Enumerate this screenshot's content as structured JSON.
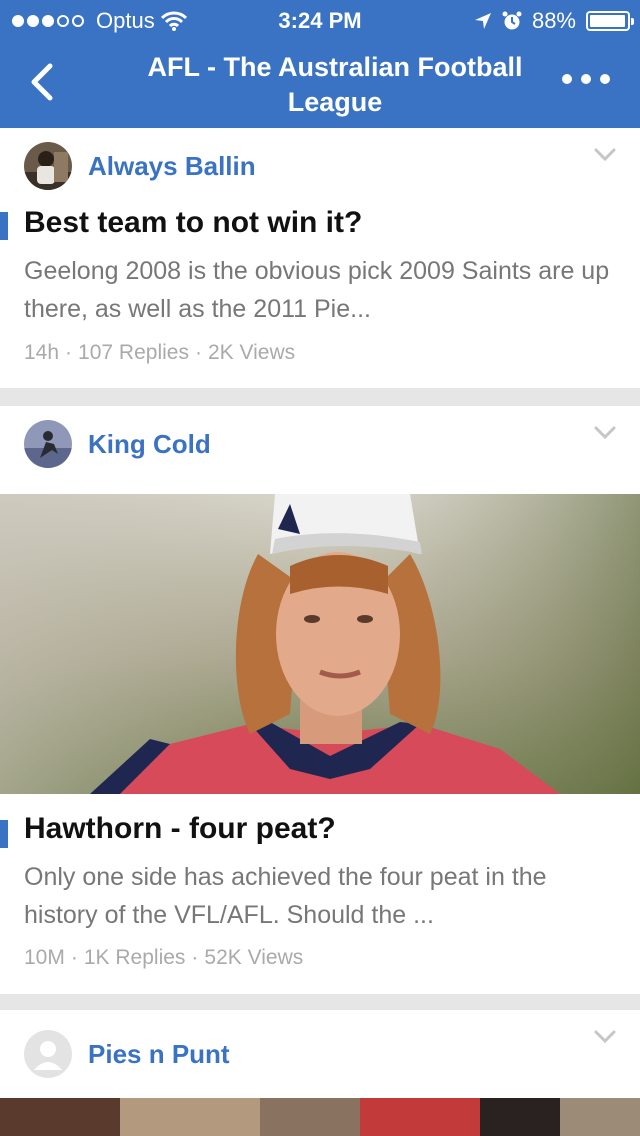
{
  "status_bar": {
    "carrier": "Optus",
    "time": "3:24 PM",
    "battery": "88%",
    "signal_bars_filled": 3,
    "signal_bars_total": 5
  },
  "nav": {
    "title": "AFL - The Australian Football League"
  },
  "colors": {
    "brand_blue": "#3a72c4"
  },
  "posts": [
    {
      "author": "Always Ballin",
      "title": "Best team to not win it?",
      "excerpt": "Geelong 2008 is the obvious pick  2009 Saints are up there, as well as the 2011 Pie...",
      "age": "14h",
      "replies": "107 Replies",
      "views": "2K Views"
    },
    {
      "author": "King Cold",
      "title": "Hawthorn - four peat?",
      "excerpt": "Only one side has achieved the four peat in the history of the VFL/AFL.  Should the ...",
      "age": "10M",
      "replies": "1K Replies",
      "views": "52K Views"
    },
    {
      "author": "Pies n Punt"
    }
  ]
}
